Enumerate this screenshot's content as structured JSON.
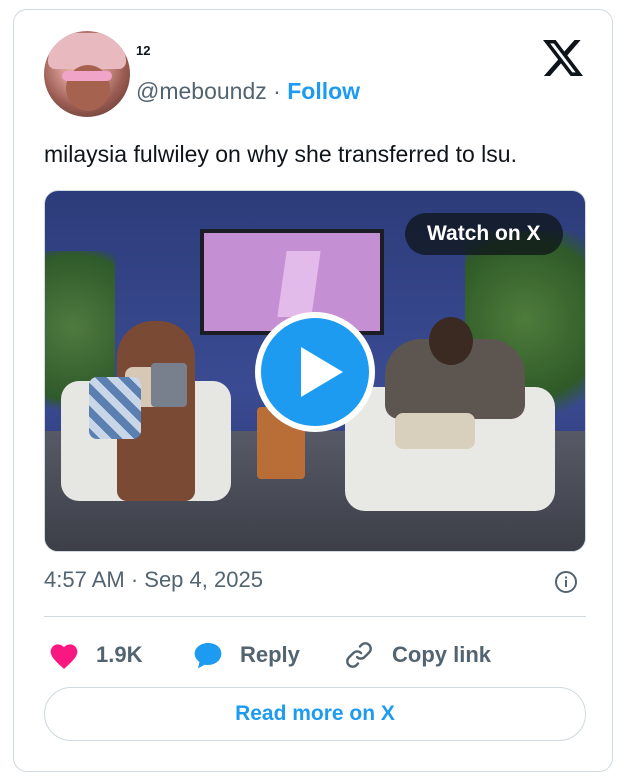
{
  "author": {
    "display_name": "12",
    "handle": "@meboundz",
    "separator": "·",
    "follow_label": "Follow"
  },
  "tweet": {
    "text": "milaysia fulwiley on why she transferred to lsu."
  },
  "media": {
    "watch_label": "Watch on X"
  },
  "meta": {
    "timestamp": "4:57 AM · Sep 4, 2025"
  },
  "actions": {
    "like_count": "1.9K",
    "reply_label": "Reply",
    "copy_label": "Copy link"
  },
  "footer": {
    "read_more_label": "Read more on X"
  },
  "icons": {
    "brand": "x-logo-icon",
    "like": "heart-icon",
    "reply": "speech-bubble-icon",
    "copy": "link-icon",
    "info": "info-icon",
    "play": "play-icon"
  },
  "colors": {
    "accent": "#1d9bf0",
    "like": "#f91880",
    "text": "#0f1419",
    "muted": "#536471",
    "border": "#cfd9de"
  }
}
